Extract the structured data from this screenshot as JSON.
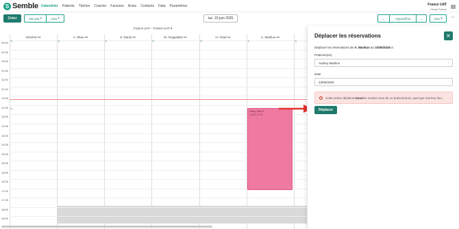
{
  "brand": {
    "name": "Semble",
    "color": "#1aa18a"
  },
  "nav": {
    "items": [
      "Calendrier",
      "Patients",
      "Tâches",
      "Courrier",
      "Factures",
      "Actes",
      "Contacts",
      "Data",
      "Paramètres"
    ],
    "active": "Calendrier"
  },
  "user": {
    "org": "France UAT",
    "name": "Cindy France",
    "icon": "user-settings-icon"
  },
  "toolbar": {
    "create_label": "Créer",
    "view_label": "Vue par",
    "place_label": "Lieu",
    "date_label": "lun. 23 juin 2025",
    "prev_label": "←",
    "today_label": "Aujourd'hui",
    "next_label": "→",
    "range_label": "Jour",
    "more_icon": "more-vertical-icon"
  },
  "calendar": {
    "timezone": "France UAT – France UAT",
    "columns": [
      "Général",
      "A. Zhao",
      "S. Damji",
      "M. Grygelaitis",
      "H. Ahad",
      "A. Manlius"
    ],
    "times": [
      "09:00",
      "09:30",
      "10:00",
      "10:30",
      "11:00",
      "11:30",
      "12:00",
      "12:30",
      "13:00",
      "13:30",
      "14:00",
      "14:30",
      "15:00",
      "15:30",
      "16:00",
      "16:30",
      "17:00",
      "17:30",
      "18:00",
      "18:30"
    ],
    "event": {
      "title": "Cindy Test 17",
      "time": "12:45 | 17:14",
      "color": "#ef7aa1"
    }
  },
  "panel": {
    "title": "Déplacer les réservations",
    "close_icon": "close-icon",
    "desc_prefix": "Déplacer les réservations de ",
    "desc_name": "A. Manlius",
    "desc_mid": " du ",
    "desc_date": "23/06/2025",
    "desc_suffix": " à :",
    "practitioner_label": "Praticien(ne)",
    "practitioner_value": "Audrey Manlius",
    "date_label": "Date",
    "date_value": "23/06/2025",
    "warning_prefix": "Cette action déplacera ",
    "warning_bold": "tous",
    "warning_suffix": " les rendez-vous de ce praticien(ne), quel que soit leur lieu.",
    "move_label": "Déplacer"
  },
  "accent": {
    "primary": "#1f7a6c",
    "warning_bg": "#fbe3e1",
    "arrow": "#e5322d"
  }
}
